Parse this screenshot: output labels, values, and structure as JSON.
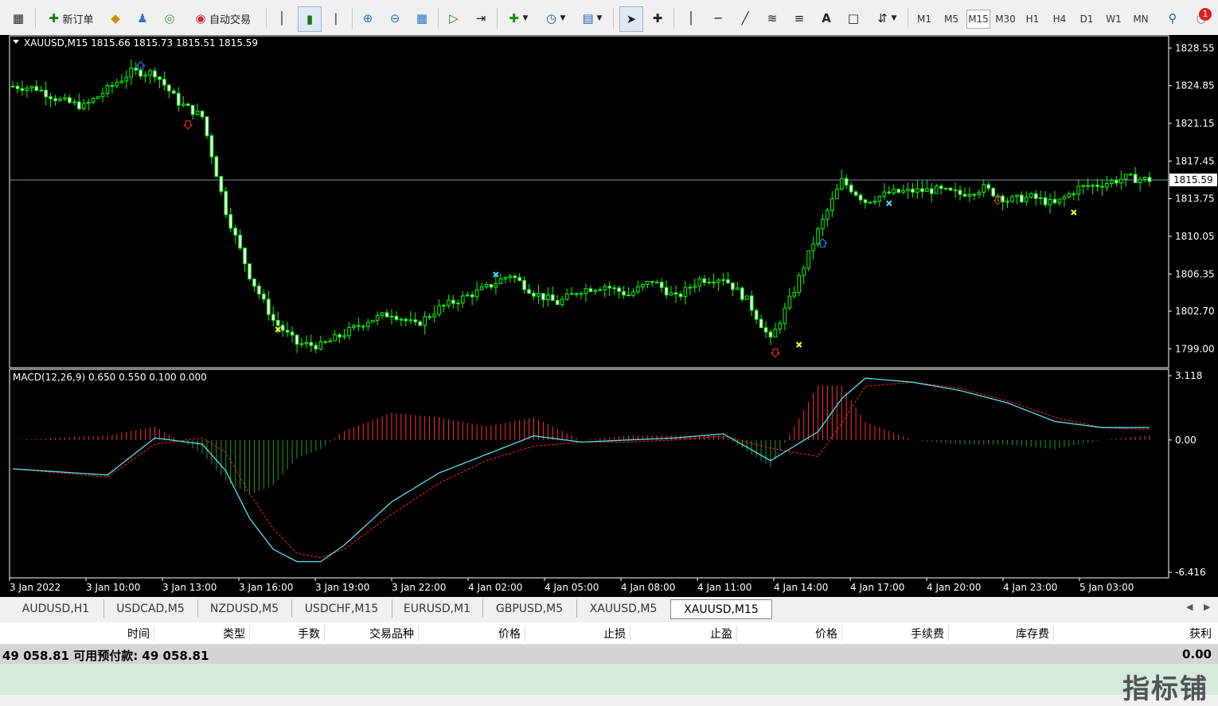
{
  "toolbar": {
    "new_order_label": "新订单",
    "auto_trading_label": "自动交易",
    "timeframes": [
      "M1",
      "M5",
      "M15",
      "M30",
      "H1",
      "H4",
      "D1",
      "W1",
      "MN"
    ],
    "active_timeframe": "M15",
    "notification_count": "1"
  },
  "price_chart": {
    "header": "XAUUSD,M15  1815.66 1815.73 1815.51 1815.59",
    "price_axis_labels": [
      "1828.55",
      "1824.85",
      "1821.15",
      "1817.45",
      "1813.75",
      "1810.05",
      "1806.35",
      "1802.70",
      "1799.00"
    ],
    "current_price": "1815.59",
    "current_price_value": 1815.59
  },
  "macd": {
    "header": "MACD(12,26,9) 0.650 0.550 0.100 0.000",
    "axis_labels": [
      "3.118",
      "0.00",
      "-6.416"
    ]
  },
  "time_axis_labels": [
    "3 Jan 2022",
    "3 Jan 10:00",
    "3 Jan 13:00",
    "3 Jan 16:00",
    "3 Jan 19:00",
    "3 Jan 22:00",
    "4 Jan 02:00",
    "4 Jan 05:00",
    "4 Jan 08:00",
    "4 Jan 11:00",
    "4 Jan 14:00",
    "4 Jan 17:00",
    "4 Jan 20:00",
    "4 Jan 23:00",
    "5 Jan 03:00"
  ],
  "chart_data": {
    "type": "line",
    "title": "XAUUSD,M15",
    "symbol": "XAUUSD",
    "timeframe": "M15",
    "ylim": [
      1797.3,
      1829.2
    ],
    "price_path": {
      "x_index": [
        0,
        5,
        10,
        15,
        20,
        25,
        30,
        35,
        40,
        45,
        50,
        55,
        60,
        65,
        70,
        75,
        80,
        85,
        90,
        95,
        100,
        105,
        110,
        115,
        120,
        125,
        130,
        135,
        140,
        145,
        150,
        155,
        160,
        165,
        170,
        175,
        180,
        185,
        190,
        195,
        200,
        205,
        210,
        215,
        220,
        225,
        230,
        235,
        240
      ],
      "close": [
        1824.8,
        1824.6,
        1823.4,
        1822.8,
        1824.5,
        1826.2,
        1826.1,
        1823.2,
        1821.8,
        1812.5,
        1806.2,
        1801.8,
        1799.5,
        1799.3,
        1800.5,
        1801.8,
        1802.5,
        1801.3,
        1803.0,
        1804.0,
        1805.0,
        1806.3,
        1804.5,
        1803.5,
        1804.8,
        1805.2,
        1804.3,
        1805.7,
        1804.0,
        1805.8,
        1806.0,
        1803.8,
        1799.8,
        1804.8,
        1810.6,
        1815.5,
        1813.5,
        1814.3,
        1814.5,
        1814.6,
        1814.2,
        1814.8,
        1813.6,
        1813.9,
        1813.2,
        1814.8,
        1815.2,
        1815.8,
        1815.6
      ]
    },
    "macd": {
      "ylim": [
        -6.416,
        3.118
      ],
      "x_index": [
        0,
        20,
        30,
        40,
        45,
        50,
        55,
        60,
        65,
        70,
        80,
        90,
        100,
        110,
        120,
        130,
        140,
        150,
        160,
        170,
        175,
        180,
        190,
        200,
        210,
        220,
        230,
        240
      ],
      "main": [
        -1.4,
        -1.7,
        0.1,
        -0.2,
        -1.5,
        -3.8,
        -5.3,
        -5.9,
        -5.9,
        -5.1,
        -3.0,
        -1.6,
        -0.7,
        0.2,
        -0.1,
        0.0,
        0.1,
        0.3,
        -1.0,
        0.4,
        2.0,
        3.0,
        2.8,
        2.4,
        1.8,
        0.9,
        0.6,
        0.6
      ],
      "signal": [
        -1.4,
        -1.8,
        -0.2,
        0.1,
        -0.6,
        -2.6,
        -4.3,
        -5.5,
        -5.7,
        -5.3,
        -3.6,
        -2.1,
        -1.0,
        -0.3,
        -0.1,
        -0.1,
        0.0,
        0.2,
        -0.4,
        -0.8,
        0.8,
        2.6,
        2.8,
        2.5,
        1.9,
        1.1,
        0.6,
        0.5
      ]
    },
    "markers": [
      {
        "type": "sell-arrow",
        "x_index": 37,
        "price": 1821.0
      },
      {
        "type": "buy-arrow",
        "x_index": 27,
        "price": 1826.8
      },
      {
        "type": "close-x",
        "x_index": 56,
        "price": 1800.9
      },
      {
        "type": "close-x",
        "x_index": 166,
        "price": 1799.4
      },
      {
        "type": "sell-arrow",
        "x_index": 161,
        "price": 1798.6
      },
      {
        "type": "close-x",
        "x_index": 224,
        "price": 1812.4
      },
      {
        "type": "buy-arrow",
        "x_index": 171,
        "price": 1809.4
      },
      {
        "type": "sell-arrow",
        "x_index": 208,
        "price": 1813.6
      },
      {
        "type": "cross",
        "x_index": 102,
        "price": 1806.3
      },
      {
        "type": "cross",
        "x_index": 185,
        "price": 1813.3
      }
    ]
  },
  "symbol_tabs": [
    "AUDUSD,H1",
    "USDCAD,M5",
    "NZDUSD,M5",
    "USDCHF,M15",
    "EURUSD,M1",
    "GBPUSD,M5",
    "XAUUSD,M5",
    "XAUUSD,M15"
  ],
  "active_tab": "XAUUSD,M15",
  "terminal": {
    "columns": [
      "时间",
      "类型",
      "手数",
      "交易品种",
      "价格",
      "止损",
      "止盈",
      "价格",
      "手续费",
      "库存费",
      "获利"
    ],
    "balance_text": "49 058.81  可用预付款: 49 058.81",
    "profit_total": "0.00",
    "watermark": "指标铺"
  },
  "colors": {
    "bull_candle": "#00ff00",
    "bear_candle": "#ffffff",
    "macd_hist_pos": "#ff3030",
    "macd_hist_neg": "#1f9f1f",
    "macd_main": "#55e0f0",
    "macd_signal": "#ff2020",
    "price_line": "#8090a0"
  }
}
